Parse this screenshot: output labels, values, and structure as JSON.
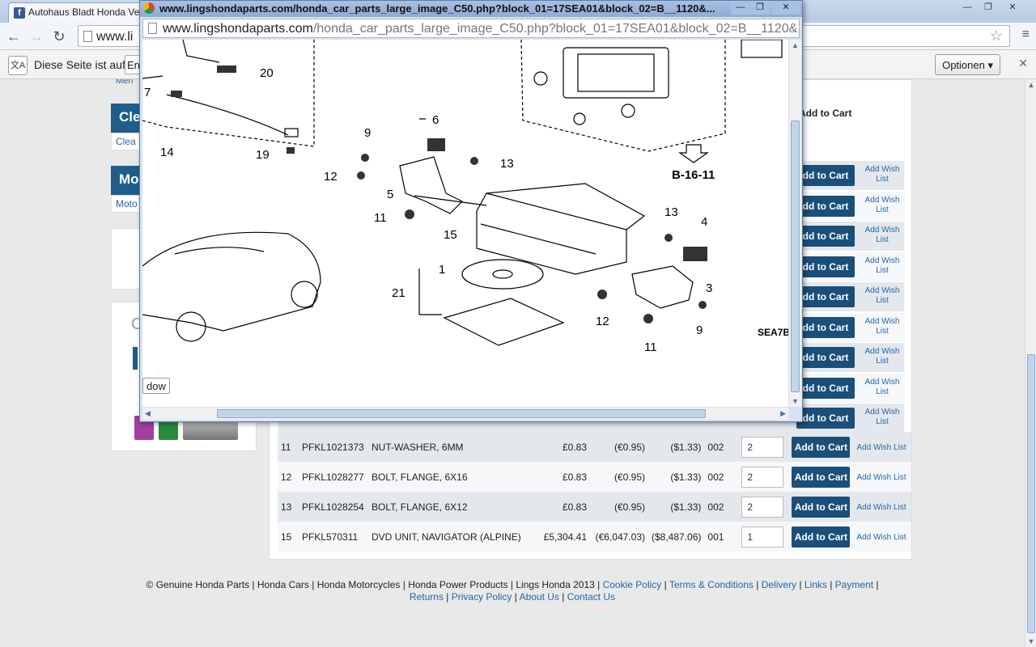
{
  "browser": {
    "tab_title": "Autohaus Bladt Honda Vertr",
    "url_visible": "www.li",
    "translate_text": "Diese Seite ist auf",
    "translate_lang": "En",
    "options_label": "Optionen ▾"
  },
  "popup": {
    "title": "www.lingshondaparts.com/honda_car_parts_large_image_C50.php?block_01=17SEA01&block_02=B__1120&...",
    "url_host": "www.lingshondaparts.com",
    "url_path": "/honda_car_parts_large_image_C50.php?block_01=17SEA01&block_02=B__1120&",
    "button_partial": "dow",
    "diagram_ref": "B-16-11",
    "diagram_code": "SEA7B",
    "callouts": [
      "20",
      "7",
      "14",
      "19",
      "9",
      "6",
      "13",
      "12",
      "5",
      "11",
      "15",
      "1",
      "21",
      "13",
      "4",
      "3",
      "12",
      "9",
      "11"
    ]
  },
  "sidebar": {
    "head1": "Cle",
    "link1": "Clea",
    "head2": "Mo",
    "link2": "Moto",
    "menu_partial": "Meri",
    "partial_letter": "C"
  },
  "parts_header": {
    "add_to_cart": "Add to Cart"
  },
  "parts": [
    {
      "ref": "11",
      "code": "PFKL1021373",
      "desc": "NUT-WASHER, 6MM",
      "gbp": "£0.83",
      "eur": "(€0.95)",
      "usd": "($1.33)",
      "pcs": "002",
      "qty": "2",
      "cart": "Add to Cart",
      "wish": "Add Wish List"
    },
    {
      "ref": "12",
      "code": "PFKL1028277",
      "desc": "BOLT, FLANGE, 6X16",
      "gbp": "£0.83",
      "eur": "(€0.95)",
      "usd": "($1.33)",
      "pcs": "002",
      "qty": "2",
      "cart": "Add to Cart",
      "wish": "Add Wish List"
    },
    {
      "ref": "13",
      "code": "PFKL1028254",
      "desc": "BOLT, FLANGE, 6X12",
      "gbp": "£0.83",
      "eur": "(€0.95)",
      "usd": "($1.33)",
      "pcs": "002",
      "qty": "2",
      "cart": "Add to Cart",
      "wish": "Add Wish List"
    },
    {
      "ref": "15",
      "code": "PFKL570311",
      "desc": "DVD UNIT, NAVIGATOR (ALPINE)",
      "gbp": "£5,304.41",
      "eur": "(€6,047.03)",
      "usd": "($8,487.06)",
      "pcs": "001",
      "qty": "1",
      "cart": "Add to Cart",
      "wish": "Add Wish List"
    }
  ],
  "hidden_rows": {
    "cart": "dd to Cart",
    "wish": "Add Wish List"
  },
  "footer": {
    "plain": "© Genuine Honda Parts | Honda Cars | Honda Motorcycles | Honda Power Products | Lings Honda 2013",
    "links": [
      "Cookie Policy",
      "Terms & Conditions",
      "Delivery",
      "Links",
      "Payment",
      "Returns",
      "Privacy Policy",
      "About Us",
      "Contact Us"
    ]
  },
  "colors": {
    "accent": "#1f5e8b",
    "cart": "#1a4f7a",
    "link": "#2266aa"
  }
}
